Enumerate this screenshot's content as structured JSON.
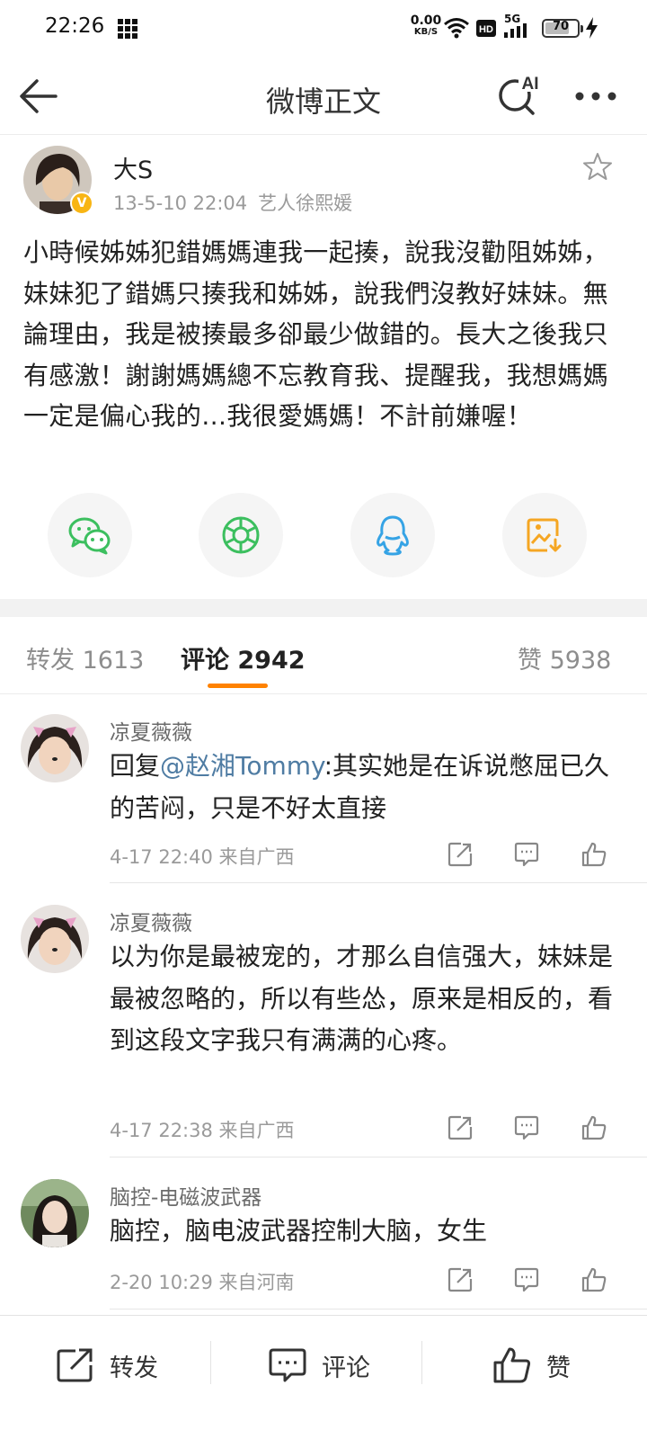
{
  "status_bar": {
    "time": "22:26",
    "net_speed_value": "0.00",
    "net_speed_unit": "KB/S",
    "hd_label": "HD",
    "network_label": "5G",
    "battery": "70"
  },
  "nav": {
    "title": "微博正文",
    "ai_label": "AI"
  },
  "post": {
    "author": "大S",
    "time": "13-5-10 22:04",
    "verify_text": "艺人徐熙媛",
    "verified_mark": "V",
    "content": "小時候姊姊犯錯媽媽連我一起揍，說我沒勸阻姊姊，妹妹犯了錯媽只揍我和姊姊，說我們沒教好妹妹。無論理由，我是被揍最多卻最少做錯的。長大之後我只有感激！謝謝媽媽總不忘教育我、提醒我，我想媽媽一定是偏心我的…我很愛媽媽！不計前嫌喔！",
    "share_targets": [
      "wechat-icon",
      "moments-icon",
      "qq-icon",
      "save-image-icon"
    ]
  },
  "tabs": {
    "repost": "转发 1613",
    "comment": "评论 2942",
    "like": "赞 5938"
  },
  "comments": [
    {
      "name": "凉夏薇薇",
      "reply_prefix": "回复",
      "mention": "@赵湘Tommy",
      "text": ":其实她是在诉说憋屈已久的苦闷，只是不好太直接",
      "time": "4-17 22:40  来自广西"
    },
    {
      "name": "凉夏薇薇",
      "text": "以为你是最被宠的，才那么自信强大，妹妹是最被忽略的，所以有些怂，原来是相反的，看到这段文字我只有满满的心疼。",
      "time": "4-17 22:38  来自广西"
    },
    {
      "name": "脑控-电磁波武器",
      "text": "脑控，脑电波武器控制大脑，女生",
      "time": "2-20 10:29  来自河南"
    }
  ],
  "bottom_bar": {
    "repost": "转发",
    "comment": "评论",
    "like": "赞"
  },
  "colors": {
    "accent": "#ff8200",
    "mention": "#4f7ca3",
    "verified": "#f8b514",
    "wechat": "#3cbf5f",
    "qq": "#35a3e5",
    "save": "#f5a623"
  }
}
